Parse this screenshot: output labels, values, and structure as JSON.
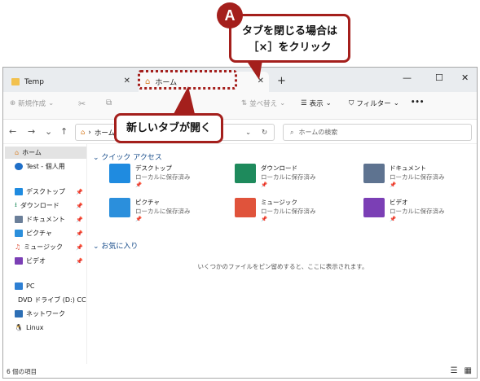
{
  "window": {
    "tabs": [
      {
        "label": "Temp",
        "close": "✕"
      },
      {
        "label": "ホーム",
        "close": "✕"
      }
    ],
    "new_tab": "+",
    "controls": {
      "minimize": "—",
      "maximize": "☐",
      "close": "✕"
    }
  },
  "toolbar": {
    "new": "新規作成",
    "sort": "並べ替え",
    "view": "表示",
    "filter": "フィルター",
    "more": "•••"
  },
  "address": {
    "path": "ホーム",
    "search_placeholder": "ホームの検索"
  },
  "sidebar": {
    "items": [
      {
        "label": "ホーム",
        "selected": true
      },
      {
        "label": "Test - 個人用"
      },
      {
        "label": "デスクトップ",
        "pinned": true
      },
      {
        "label": "ダウンロード",
        "pinned": true
      },
      {
        "label": "ドキュメント",
        "pinned": true
      },
      {
        "label": "ピクチャ",
        "pinned": true
      },
      {
        "label": "ミュージック",
        "pinned": true
      },
      {
        "label": "ビデオ",
        "pinned": true
      },
      {
        "label": "PC"
      },
      {
        "label": "DVD ドライブ (D:) CCCOMA"
      },
      {
        "label": "ネットワーク"
      },
      {
        "label": "Linux"
      }
    ]
  },
  "main": {
    "quick_access": "クイック アクセス",
    "favorites": "お気に入り",
    "folders": [
      {
        "name": "デスクトップ",
        "sub": "ローカルに保存済み"
      },
      {
        "name": "ダウンロード",
        "sub": "ローカルに保存済み"
      },
      {
        "name": "ドキュメント",
        "sub": "ローカルに保存済み"
      },
      {
        "name": "ピクチャ",
        "sub": "ローカルに保存済み"
      },
      {
        "name": "ミュージック",
        "sub": "ローカルに保存済み"
      },
      {
        "name": "ビデオ",
        "sub": "ローカルに保存済み"
      }
    ],
    "favorites_empty": "いくつかのファイルをピン留めすると、ここに表示されます。"
  },
  "status": {
    "count": "6 個の項目"
  },
  "annotations": {
    "badge": "A",
    "callout_close": [
      "タブを閉じる場合は",
      "［×］をクリック"
    ],
    "callout_open": "新しいタブが開く"
  },
  "colors": {
    "accent": "#a41f1c",
    "link": "#1b4f8c"
  }
}
